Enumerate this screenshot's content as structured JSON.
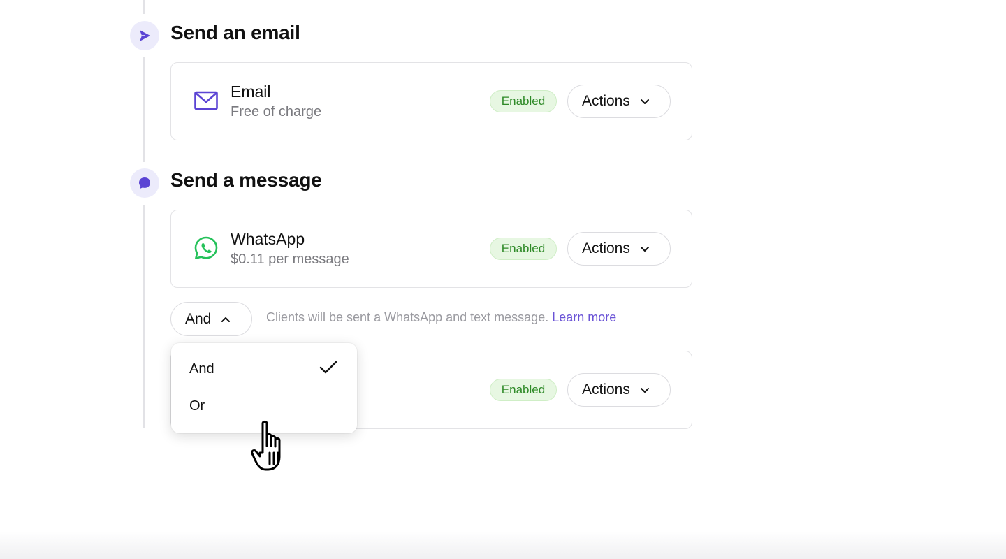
{
  "sections": [
    {
      "title": "Send an email",
      "card": {
        "name": "Email",
        "price": "Free of charge",
        "status": "Enabled",
        "actions_label": "Actions",
        "icon": "envelope-icon"
      }
    },
    {
      "title": "Send a message",
      "card": {
        "name": "WhatsApp",
        "price": "$0.11 per message",
        "status": "Enabled",
        "actions_label": "Actions",
        "icon": "whatsapp-icon"
      },
      "second_card": {
        "status": "Enabled",
        "actions_label": "Actions"
      }
    }
  ],
  "combinator": {
    "selected": "And",
    "helper_text": "Clients will be sent a WhatsApp and text message.",
    "learn_more": "Learn more",
    "options": [
      {
        "label": "And",
        "selected": true
      },
      {
        "label": "Or",
        "selected": false
      }
    ]
  },
  "colors": {
    "accent": "#6a53d6",
    "enabled_bg": "#e7f7e2",
    "enabled_text": "#2e8a27",
    "whatsapp": "#25c15a"
  }
}
